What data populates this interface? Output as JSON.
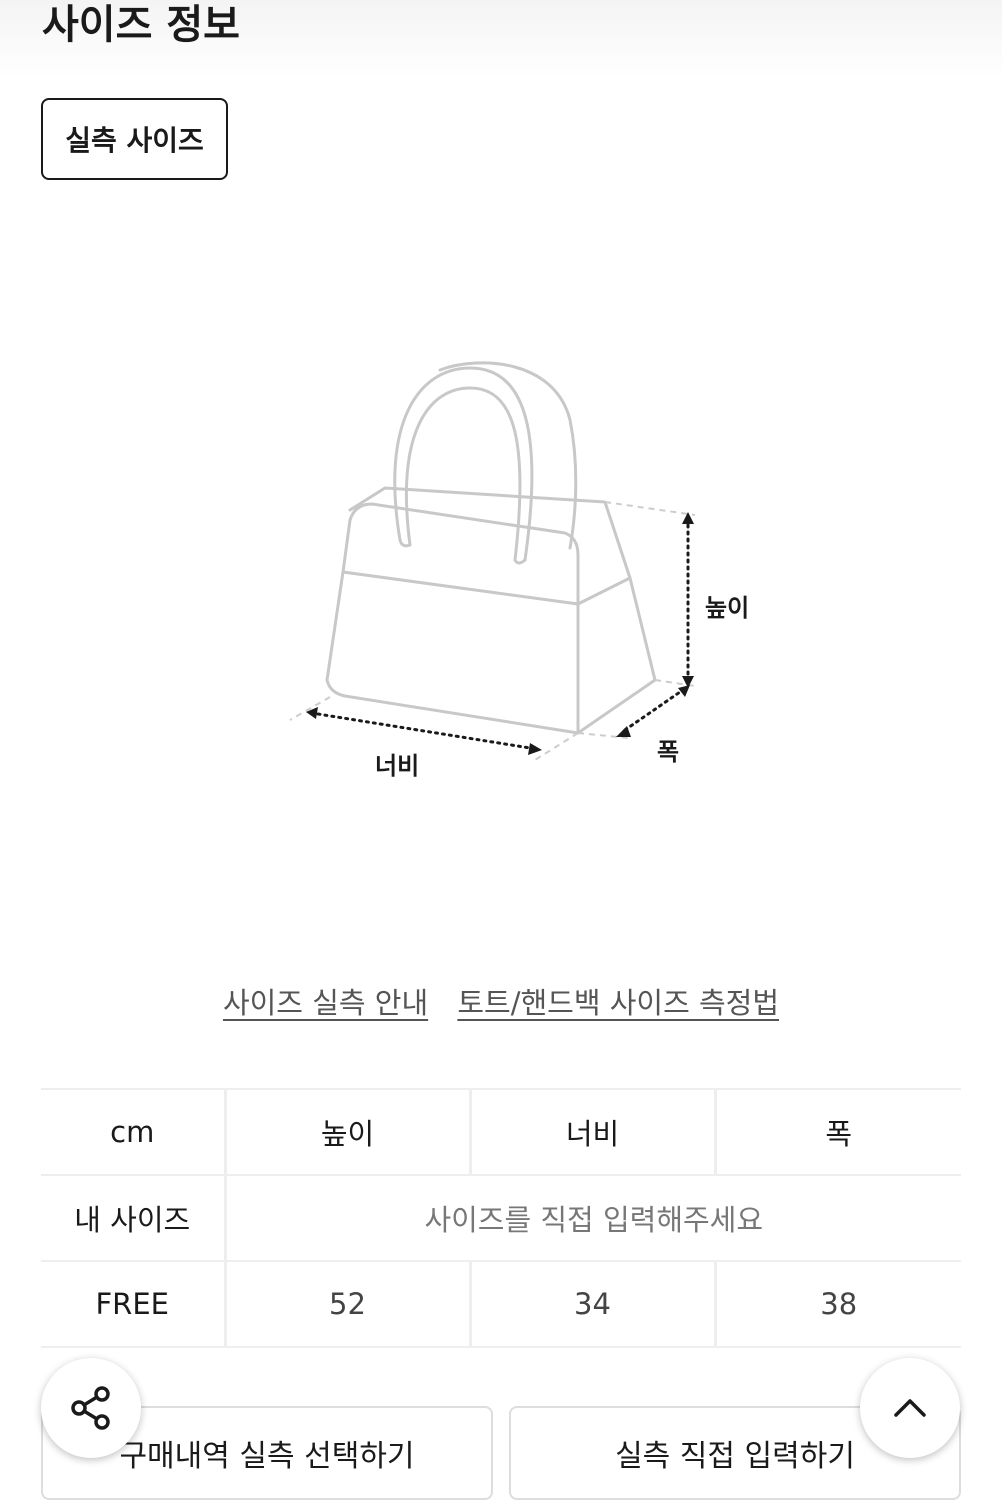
{
  "header": {
    "title": "사이즈 정보"
  },
  "tabs": {
    "active_label": "실측 사이즈"
  },
  "illustration": {
    "label_height": "높이",
    "label_width": "너비",
    "label_depth": "폭"
  },
  "links": {
    "guide": "사이즈 실측 안내",
    "measure_method": "토트/핸드백 사이즈 측정법"
  },
  "table": {
    "columns": [
      "cm",
      "높이",
      "너비",
      "폭"
    ],
    "my_size": {
      "label": "내 사이즈",
      "placeholder": "사이즈를 직접 입력해주세요"
    },
    "rows": [
      {
        "label": "FREE",
        "values": [
          "52",
          "34",
          "38"
        ]
      }
    ]
  },
  "actions": {
    "purchase_history": "구매내역 실측 선택하기",
    "manual_input": "실측 직접 입력하기"
  },
  "icons": {
    "share": "share-icon",
    "scroll_top": "chevron-up-icon"
  }
}
